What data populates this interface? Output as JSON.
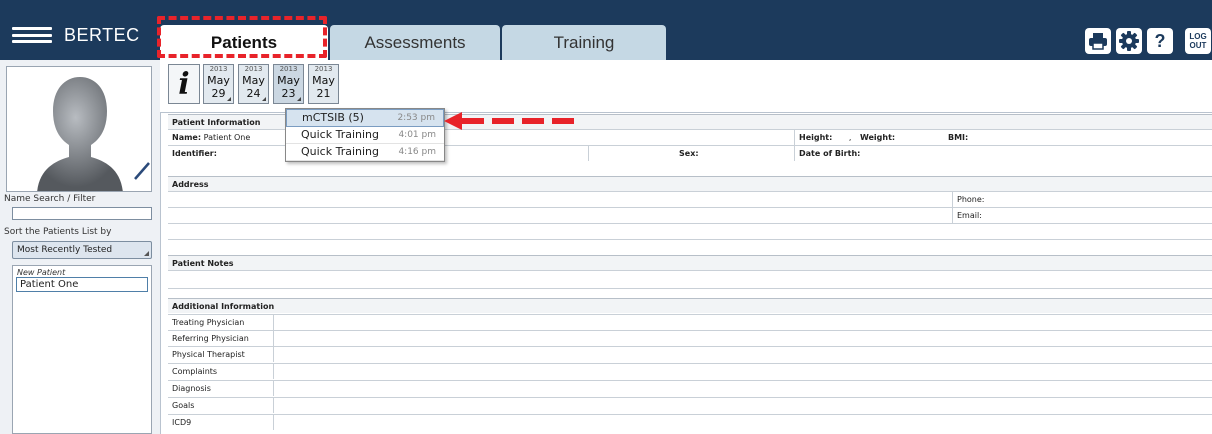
{
  "app": {
    "name": "BERTEC"
  },
  "tabs": [
    {
      "label": "Patients",
      "active": true
    },
    {
      "label": "Assessments",
      "active": false
    },
    {
      "label": "Training",
      "active": false
    }
  ],
  "toolbar": {
    "print_icon": "printer-icon",
    "settings_icon": "gear-icon",
    "help_label": "?",
    "logout_line1": "LOG",
    "logout_line2": "OUT"
  },
  "colors": {
    "topbar": "#1c3a5c",
    "highlight": "#e8232a",
    "tab_inactive": "#c5d8e4"
  },
  "left_panel": {
    "search_label": "Name Search / Filter",
    "search_value": "",
    "sort_label": "Sort the Patients List by",
    "sort_value": "Most Recently Tested",
    "list_header": "New Patient",
    "patients": [
      "Patient One"
    ]
  },
  "sessions": [
    {
      "year": "2013",
      "month": "May",
      "day": "29"
    },
    {
      "year": "2013",
      "month": "May",
      "day": "24"
    },
    {
      "year": "2013",
      "month": "May",
      "day": "23"
    },
    {
      "year": "2013",
      "month": "May",
      "day": "21"
    }
  ],
  "session_menu": [
    {
      "name": "mCTSIB (5)",
      "time": "2:53 pm"
    },
    {
      "name": "Quick Training",
      "time": "4:01 pm"
    },
    {
      "name": "Quick Training",
      "time": "4:16 pm"
    }
  ],
  "patient_info": {
    "header": "Patient Information",
    "name_label": "Name:",
    "name_value": "Patient One",
    "height_label": "Height:",
    "height_sep": ",",
    "weight_label": "Weight:",
    "bmi_label": "BMI:",
    "identifier_label": "Identifier:",
    "sex_label": "Sex:",
    "dob_label": "Date of Birth:"
  },
  "address": {
    "header": "Address",
    "phone_label": "Phone:",
    "email_label": "Email:"
  },
  "notes": {
    "header": "Patient Notes"
  },
  "additional": {
    "header": "Additional Information",
    "fields": [
      "Treating Physician",
      "Referring Physician",
      "Physical Therapist",
      "Complaints",
      "Diagnosis",
      "Goals",
      "ICD9"
    ]
  }
}
